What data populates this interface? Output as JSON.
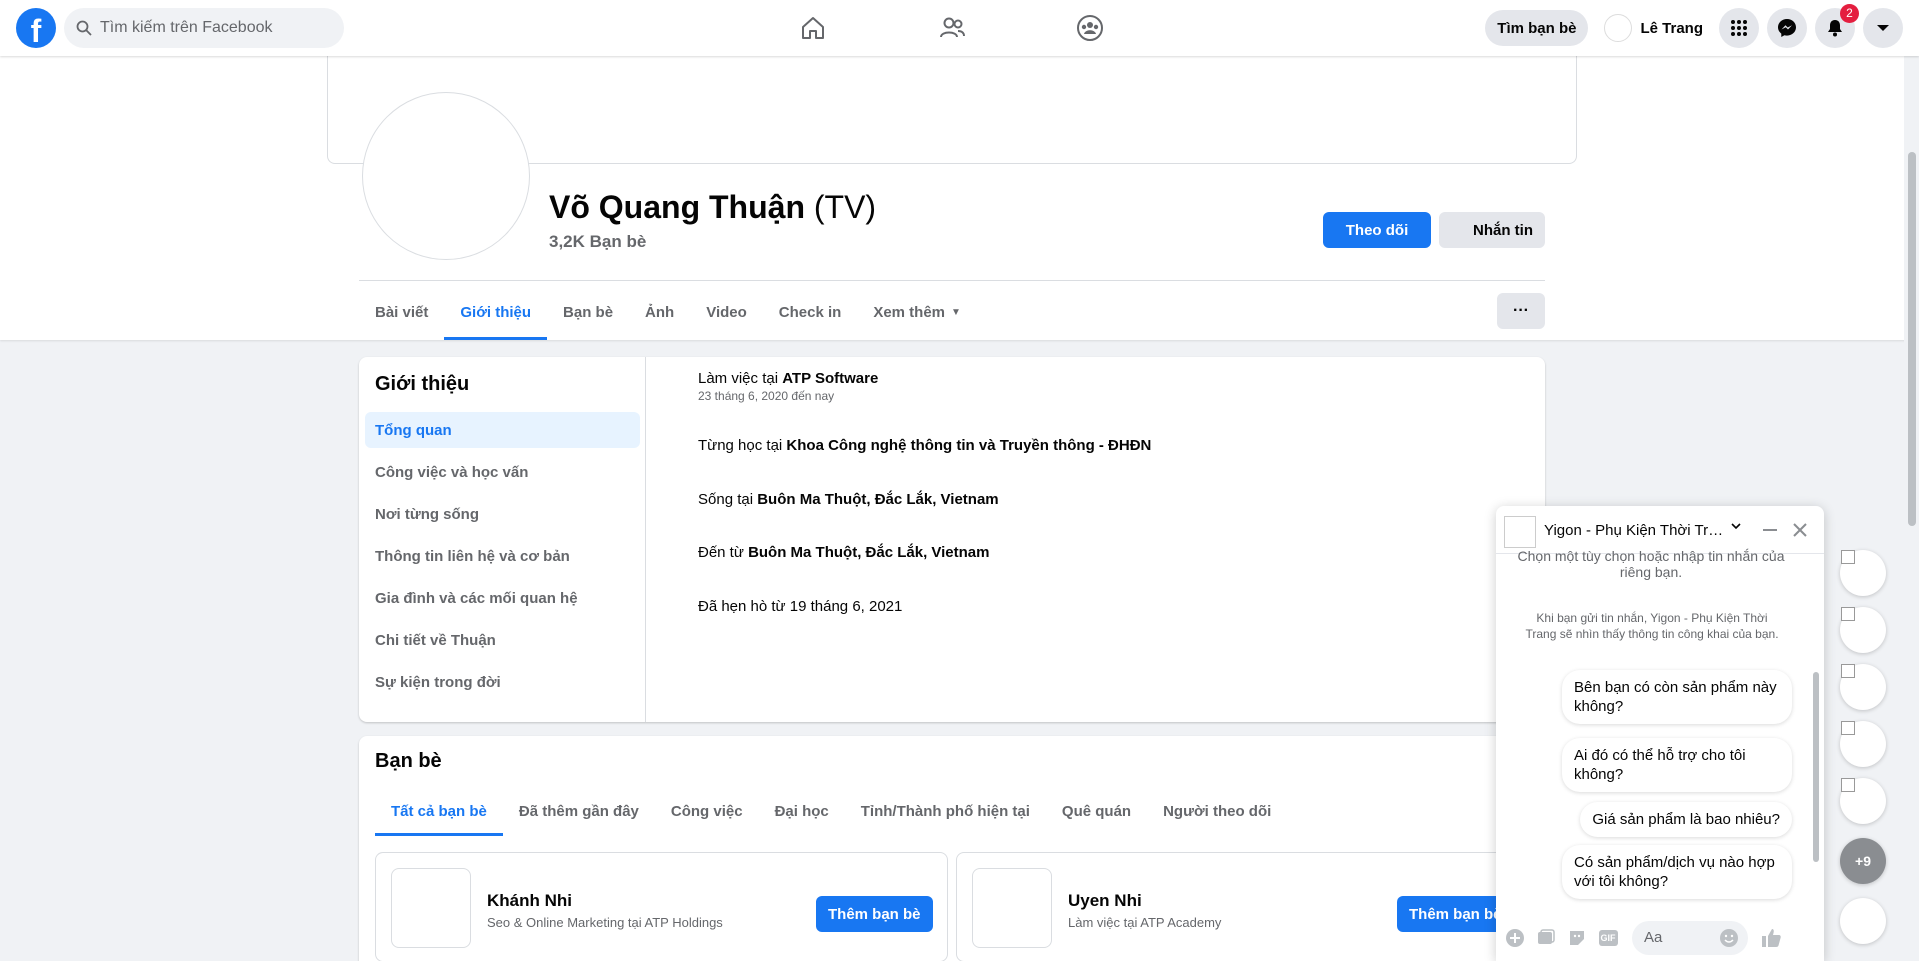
{
  "topnav": {
    "logo": "f",
    "search_placeholder": "Tìm kiếm trên Facebook",
    "find_friends": "Tìm bạn bè",
    "user_name": "Lê Trang",
    "notifications_count": "2"
  },
  "profile": {
    "name": "Võ Quang Thuận",
    "alt_name": "(TV)",
    "friends": "3,2K Bạn bè",
    "follow_button": "Theo dõi",
    "message_button": "Nhắn tin",
    "more_button": "···",
    "tabs": [
      "Bài viết",
      "Giới thiệu",
      "Bạn bè",
      "Ảnh",
      "Video",
      "Check in",
      "Xem thêm"
    ],
    "more_tab_caret": "▼"
  },
  "about": {
    "title": "Giới thiệu",
    "nav": [
      "Tổng quan",
      "Công việc và học vấn",
      "Nơi từng sống",
      "Thông tin liên hệ và cơ bản",
      "Gia đình và các mối quan hệ",
      "Chi tiết về Thuận",
      "Sự kiện trong đời"
    ],
    "work_prefix": "Làm việc tại ",
    "work_place": "ATP Software",
    "work_date": "23 tháng 6, 2020 đến nay",
    "study_prefix": "Từng học tại ",
    "study_place": "Khoa Công nghệ thông tin và Truyền thông - ĐHĐN",
    "live_prefix": "Sống tại ",
    "live_place": "Buôn Ma Thuột, Đắc Lắk, Vietnam",
    "from_prefix": "Đến từ ",
    "from_place": "Buôn Ma Thuột, Đắc Lắk, Vietnam",
    "dating": "Đã hẹn hò từ 19 tháng 6, 2021"
  },
  "friends": {
    "title": "Bạn bè",
    "tabs": [
      "Tất cả bạn bè",
      "Đã thêm gần đây",
      "Công việc",
      "Đại học",
      "Tỉnh/Thành phố hiện tại",
      "Quê quán",
      "Người theo dõi"
    ],
    "items": [
      {
        "name": "Khánh Nhi",
        "desc": "Seo & Online Marketing tại ATP Holdings",
        "button": "Thêm bạn bè"
      },
      {
        "name": "Uyen Nhi",
        "desc": "Làm việc tại ATP Academy",
        "button": "Thêm bạn bè"
      }
    ]
  },
  "chat": {
    "name": "Yigon - Phụ Kiện Thời Trang",
    "info": "Chọn một tùy chọn hoặc nhập tin nhắn của riêng bạn.",
    "privacy": "Khi bạn gửi tin nhắn, Yigon - Phụ Kiện Thời Trang sẽ nhìn thấy thông tin công khai của bạn.",
    "quick_replies": [
      "Bên bạn có còn sản phẩm này không?",
      "Ai đó có thể hỗ trợ cho tôi không?",
      "Giá sản phẩm là bao nhiêu?",
      "Có sản phẩm/dịch vụ nào hợp với tôi không?"
    ],
    "input_placeholder": "Aa",
    "gif_label": "GIF"
  },
  "chat_heads": {
    "more_count": "+9"
  },
  "colors": {
    "brand": "#1877f2",
    "badge": "#e41e3f",
    "secondary_text": "#65676b",
    "page_bg": "#f0f2f5"
  },
  "icons": [
    "search-icon",
    "home-icon",
    "friends-icon",
    "groups-icon",
    "menu-grid-icon",
    "messenger-icon",
    "bell-icon",
    "account-caret-icon",
    "dropdown-icon",
    "minimize-icon",
    "close-icon",
    "plus-icon",
    "image-icon",
    "sticker-icon",
    "gif-icon",
    "emoji-icon",
    "like-icon"
  ]
}
